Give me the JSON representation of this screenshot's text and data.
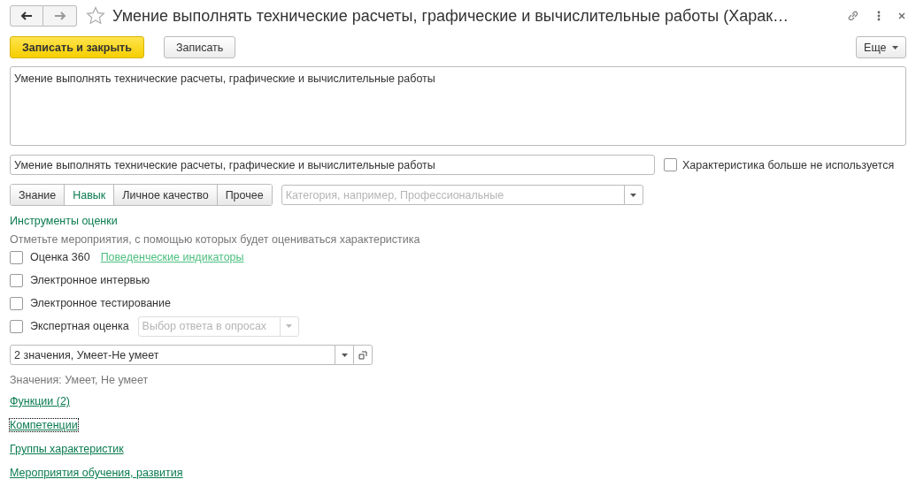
{
  "window": {
    "title": "Умение выполнять технические расчеты, графические и вычислительные работы (Харак…",
    "favorite": false
  },
  "toolbar": {
    "primary_button": "Записать и закрыть",
    "button": "Записать",
    "more_button": "Еще"
  },
  "description": "Умение выполнять технические расчеты, графические и вычислительные работы",
  "name_field": {
    "value": "Умение выполнять технические расчеты, графические и вычислительные работы"
  },
  "not_used": {
    "label": "Характеристика больше не используется",
    "checked": false
  },
  "type_tabs": [
    {
      "label": "Знание",
      "selected": false
    },
    {
      "label": "Навык",
      "selected": true
    },
    {
      "label": "Личное качество",
      "selected": false
    },
    {
      "label": "Прочее",
      "selected": false
    }
  ],
  "category": {
    "placeholder": "Категория, например, Профессиональные"
  },
  "assessment": {
    "heading": "Инструменты оценки",
    "hint": "Отметьте мероприятия, с помощью которых будет оцениваться характеристика",
    "items": [
      {
        "label": "Оценка 360",
        "checked": false,
        "link": "Поведенческие индикаторы"
      },
      {
        "label": "Электронное интервью",
        "checked": false
      },
      {
        "label": "Электронное тестирование",
        "checked": false
      },
      {
        "label": "Экспертная оценка",
        "checked": false,
        "select_placeholder": "Выбор ответа в опросах"
      }
    ]
  },
  "scale": {
    "value": "2 значения, Умеет-Не умеет",
    "values_text": "Значения: Умеет, Не умеет"
  },
  "links": [
    {
      "label": "Функции (2)",
      "focused": false
    },
    {
      "label": "Компетенции",
      "focused": true
    },
    {
      "label": "Группы характеристик",
      "focused": false
    },
    {
      "label": "Мероприятия обучения, развития",
      "focused": false
    }
  ]
}
